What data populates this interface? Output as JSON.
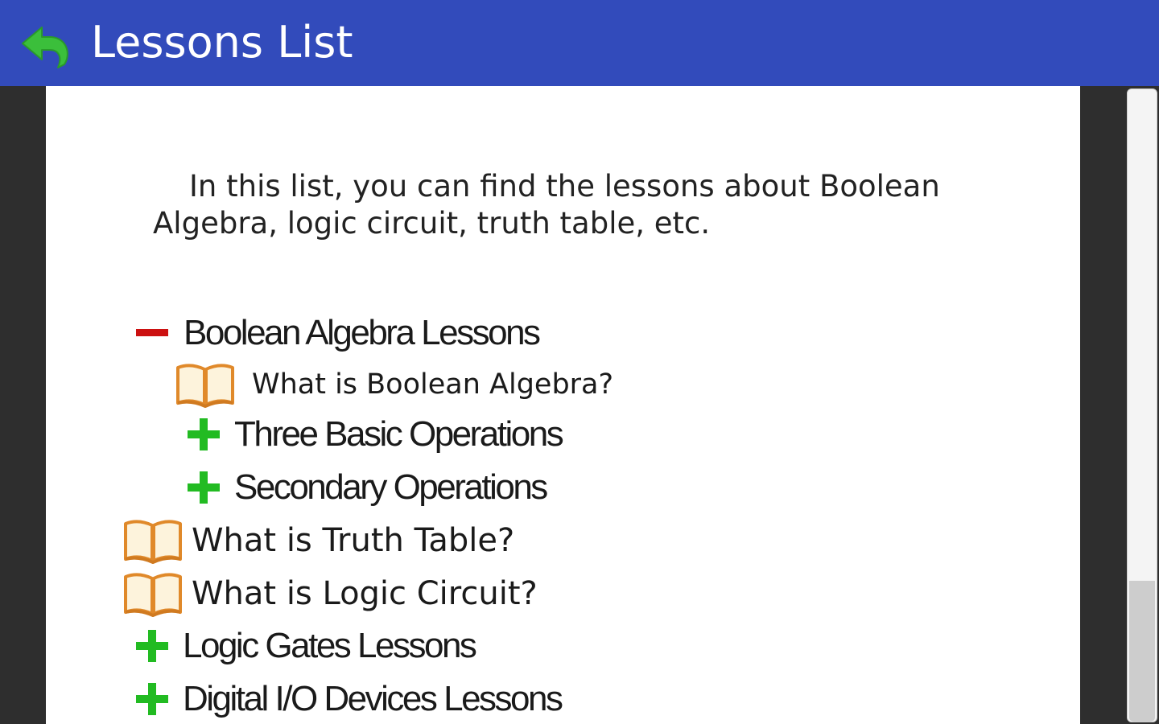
{
  "app_bar": {
    "title": "Lessons List",
    "back_icon": "back-arrow-icon",
    "color": "#324bbb"
  },
  "intro": {
    "text": "In this list, you can find the lessons about Boolean Algebra, logic circuit, truth table, etc."
  },
  "tree": {
    "items": [
      {
        "label": "Boolean Algebra Lessons",
        "icon": "collapse-minus-icon",
        "state": "expanded"
      },
      {
        "label": "What is Boolean Algebra?",
        "icon": "book-icon"
      },
      {
        "label": "Three Basic Operations",
        "icon": "expand-plus-icon",
        "state": "collapsed"
      },
      {
        "label": "Secondary Operations",
        "icon": "expand-plus-icon",
        "state": "collapsed"
      },
      {
        "label": "What is Truth Table?",
        "icon": "book-icon"
      },
      {
        "label": "What is Logic Circuit?",
        "icon": "book-icon"
      },
      {
        "label": "Logic Gates Lessons",
        "icon": "expand-plus-icon",
        "state": "collapsed"
      },
      {
        "label": "Digital I/O Devices Lessons",
        "icon": "expand-plus-icon",
        "state": "collapsed"
      }
    ]
  },
  "colors": {
    "minus": "#cc1111",
    "plus": "#22bb22",
    "back_arrow": "#3bbf3b"
  }
}
